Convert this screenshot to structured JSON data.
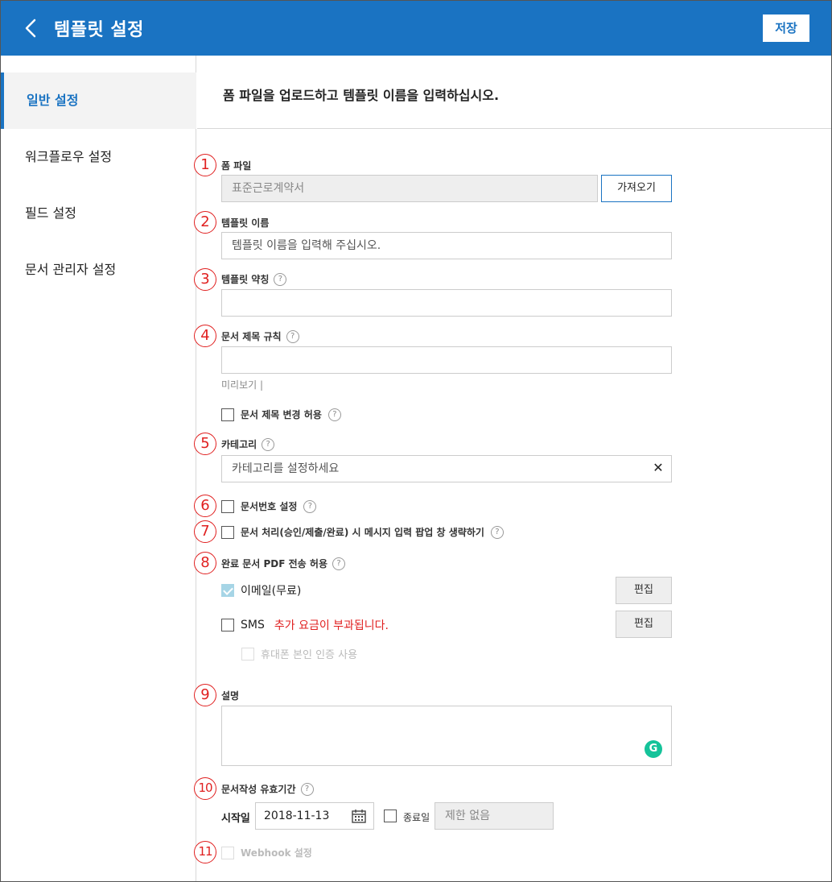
{
  "header": {
    "title": "템플릿 설정",
    "save_label": "저장"
  },
  "sidebar": {
    "items": [
      {
        "label": "일반 설정",
        "active": true
      },
      {
        "label": "워크플로우 설정",
        "active": false
      },
      {
        "label": "필드 설정",
        "active": false
      },
      {
        "label": "문서 관리자 설정",
        "active": false
      }
    ]
  },
  "main": {
    "intro": "폼 파일을 업로드하고 템플릿 이름을 입력하십시오.",
    "markers": [
      "1",
      "2",
      "3",
      "4",
      "5",
      "6",
      "7",
      "8",
      "9",
      "10",
      "11"
    ],
    "form_file": {
      "label": "폼 파일",
      "value": "표준근로계약서",
      "import_label": "가져오기"
    },
    "template_name": {
      "label": "템플릿 이름",
      "placeholder": "템플릿 이름을 입력해 주십시오."
    },
    "template_abbr": {
      "label": "템플릿 약칭",
      "value": ""
    },
    "doc_title_rule": {
      "label": "문서 제목 규칙",
      "value": "",
      "preview_label": "미리보기 |"
    },
    "allow_title_change": {
      "label": "문서 제목 변경 허용",
      "checked": false
    },
    "category": {
      "label": "카테고리",
      "placeholder": "카테고리를 설정하세요",
      "clear_icon": "✕"
    },
    "doc_number": {
      "label": "문서번호 설정",
      "checked": false
    },
    "skip_popup": {
      "label": "문서 처리(승인/제출/완료) 시 메시지 입력 팝업 창 생략하기",
      "checked": false
    },
    "pdf_send": {
      "label": "완료 문서 PDF 전송 허용",
      "email": {
        "label": "이메일(무료)",
        "checked": true,
        "edit_label": "편집"
      },
      "sms": {
        "label": "SMS",
        "note": "추가 요금이 부과됩니다.",
        "checked": false,
        "edit_label": "편집"
      },
      "phone_auth": {
        "label": "휴대폰 본인 인증 사용",
        "checked": false
      }
    },
    "description": {
      "label": "설명",
      "value": "",
      "grammar_badge": "G"
    },
    "validity": {
      "label": "문서작성 유효기간",
      "start_label": "시작일",
      "start_date": "2018-11-13",
      "end_label": "종료일",
      "end_placeholder": "제한 없음",
      "end_checked": false
    },
    "webhook": {
      "label": "Webhook 설정",
      "checked": false
    }
  },
  "colors": {
    "brand": "#1a73c2",
    "marker": "#e02020",
    "grammar": "#15c39a"
  },
  "help_icon": "?"
}
